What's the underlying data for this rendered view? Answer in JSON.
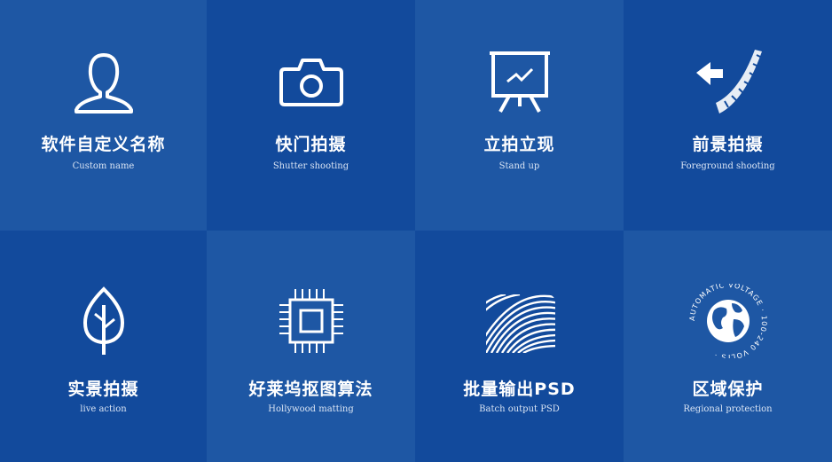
{
  "features": [
    {
      "title": "软件自定义名称",
      "subtitle": "Custom name",
      "icon": "user-icon"
    },
    {
      "title": "快门拍摄",
      "subtitle": "Shutter shooting",
      "icon": "camera-icon"
    },
    {
      "title": "立拍立现",
      "subtitle": "Stand up",
      "icon": "presentation-board-icon"
    },
    {
      "title": "前景拍摄",
      "subtitle": "Foreground shooting",
      "icon": "foreground-arrow-icon"
    },
    {
      "title": "实景拍摄",
      "subtitle": "live action",
      "icon": "leaf-icon"
    },
    {
      "title": "好莱坞抠图算法",
      "subtitle": "Hollywood matting",
      "icon": "chip-icon"
    },
    {
      "title": "批量输出PSD",
      "subtitle": "Batch output PSD",
      "icon": "wave-pattern-icon"
    },
    {
      "title": "区域保护",
      "subtitle": "Regional protection",
      "icon": "globe-icon"
    }
  ],
  "globe_badge": {
    "ring_text": "AUTOMATIC VOLTAGE · 100-240 VOLTS ·"
  },
  "colors": {
    "background_dark": "#124a9c",
    "background_light": "#1e57a4",
    "text": "#ffffff"
  }
}
